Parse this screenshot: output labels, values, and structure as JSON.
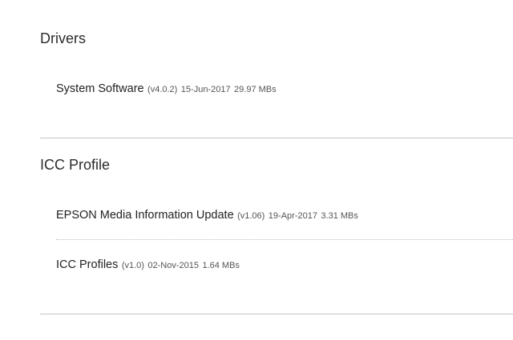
{
  "drivers": {
    "title": "Drivers",
    "items": [
      {
        "name": "System Software",
        "version": "(v4.0.2)",
        "date": "15-Jun-2017",
        "size": "29.97 MBs"
      }
    ]
  },
  "icc_profile": {
    "title": "ICC Profile",
    "items": [
      {
        "name": "EPSON Media Information Update",
        "version": "(v1.06)",
        "date": "19-Apr-2017",
        "size": "3.31 MBs"
      },
      {
        "name": "ICC Profiles",
        "version": "(v1.0)",
        "date": "02-Nov-2015",
        "size": "1.64 MBs"
      }
    ]
  }
}
